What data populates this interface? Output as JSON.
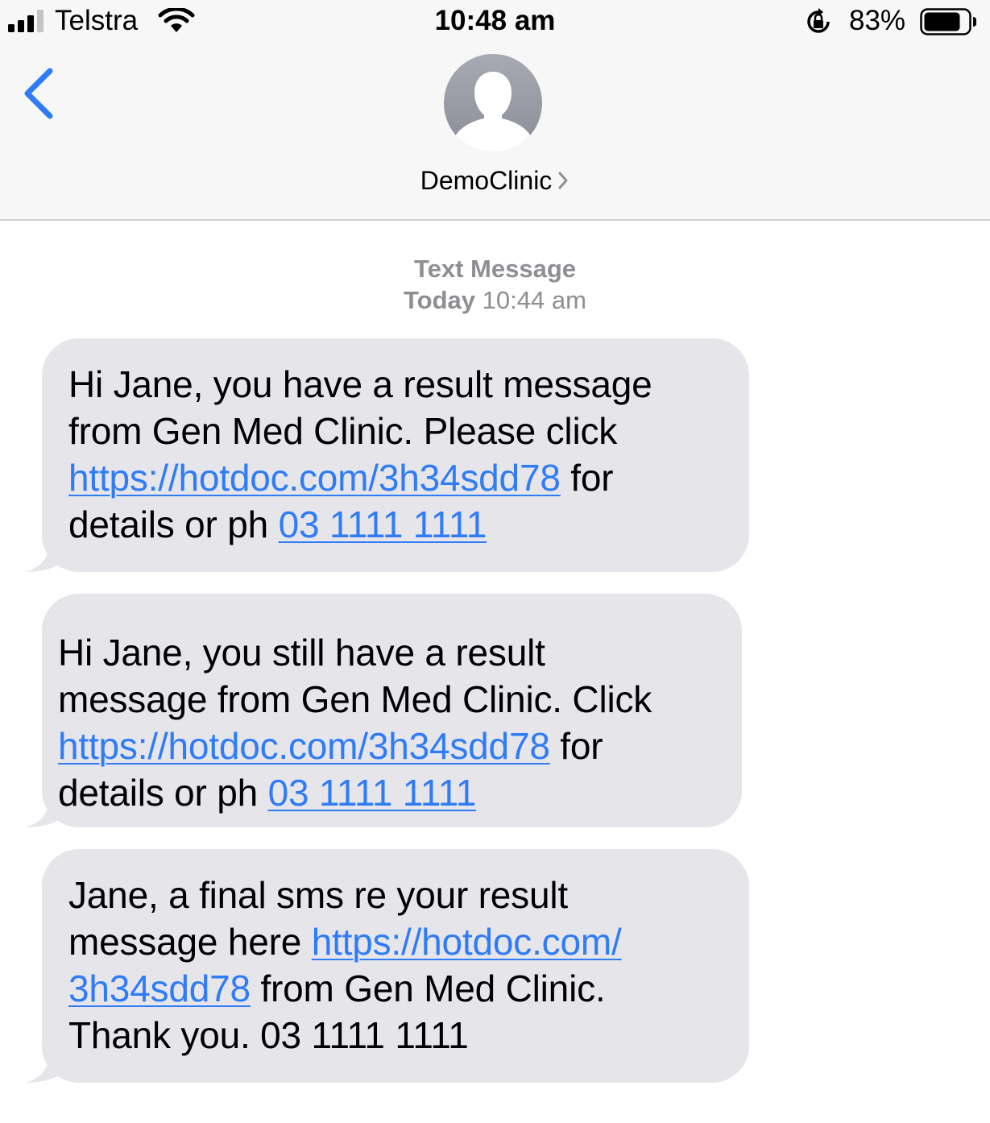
{
  "status_bar": {
    "carrier": "Telstra",
    "time": "10:48 am",
    "battery_percent": "83%",
    "battery_level": 0.83,
    "icons": [
      "signal-icon",
      "wifi-icon",
      "orientation-lock-icon",
      "battery-icon"
    ]
  },
  "nav": {
    "back_icon": "chevron-left-icon",
    "contact_name": "DemoClinic",
    "contact_chevron": ">",
    "avatar_icon": "person-silhouette-icon"
  },
  "thread": {
    "kind": "Text Message",
    "day": "Today",
    "time": "10:44 am"
  },
  "messages": [
    {
      "lines": [
        {
          "text": "Hi Jane, you have a result message"
        },
        {
          "text": "from Gen Med Clinic. Please click"
        },
        {
          "link": "https://hotdoc.com/3h34sdd78",
          "after": " for"
        },
        {
          "text": "details or ph ",
          "link": "03 1111 1111"
        }
      ]
    },
    {
      "lines": [
        {
          "text": "Hi Jane, you still have a result"
        },
        {
          "text": "message from Gen Med Clinic. Click"
        },
        {
          "link": "https://hotdoc.com/3h34sdd78",
          "after": " for"
        },
        {
          "text": "details or ph ",
          "link": "03 1111 1111"
        }
      ]
    },
    {
      "lines": [
        {
          "text": "Jane, a final sms re your result"
        },
        {
          "text": "message here ",
          "link": "https://hotdoc.com/"
        },
        {
          "link": "3h34sdd78",
          "after": " from Gen Med Clinic."
        },
        {
          "text": "Thank you. 03 1111 1111"
        }
      ]
    }
  ],
  "colors": {
    "link": "#2f7cf6",
    "bubble": "#e5e5ea",
    "header_bg": "#f7f7f7",
    "meta_text": "#8e8e93"
  }
}
